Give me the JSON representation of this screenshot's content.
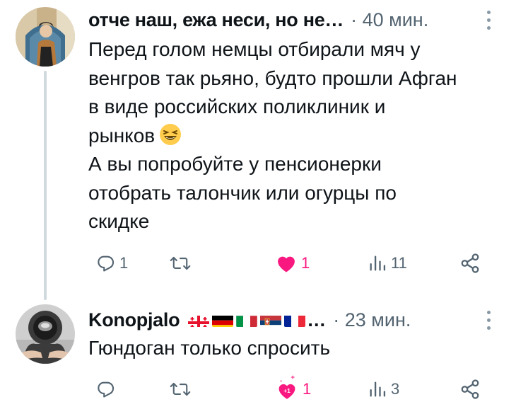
{
  "tweets": [
    {
      "author": "отче наш, ежа неси, но не…",
      "time": "· 40 мин.",
      "text_lines": [
        "Перед голом немцы отбирали мяч у",
        "венгров так рьяно, будто прошли Афган",
        "в виде российских поликлиник и",
        "рынков",
        "А вы попробуйте у пенсионерки",
        "отобрать талончик или огурцы по",
        "скидке"
      ],
      "emoji": "laughing-emoji",
      "replies": "1",
      "retweets": "",
      "likes": "1",
      "views": "11"
    },
    {
      "author": "Konopjalo",
      "flags": [
        "georgia-flag",
        "germany-flag",
        "italy-flag",
        "serbia-flag",
        "france-flag"
      ],
      "ellipsis": "…",
      "time": "· 23 мин.",
      "text_lines": [
        "Гюндоган только спросить"
      ],
      "replies": "",
      "retweets": "",
      "likes": "1",
      "like_badge": "+1",
      "views": "3"
    }
  ],
  "icons": {
    "reply": "reply-icon",
    "retweet": "retweet-icon",
    "like": "heart-icon",
    "views": "views-icon",
    "share": "share-icon",
    "more": "more-icon"
  },
  "colors": {
    "text": "#0f1419",
    "secondary": "#536471",
    "like": "#f91880",
    "thread_line": "#cfd9de"
  }
}
